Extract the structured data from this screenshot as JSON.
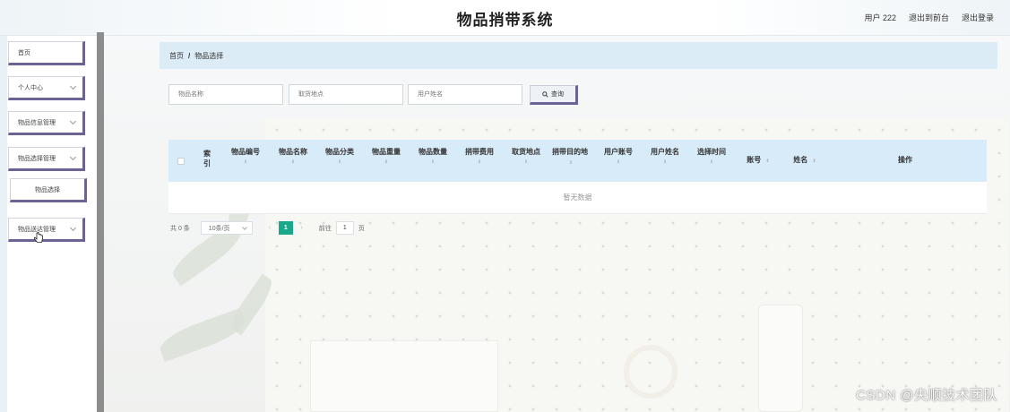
{
  "app": {
    "title": "物品捎带系统"
  },
  "header_links": {
    "user": "用户 222",
    "back_front": "退出到前台",
    "logout": "退出登录"
  },
  "sidebar": {
    "items": [
      {
        "label": "首页"
      },
      {
        "label": "个人中心"
      },
      {
        "label": "物品信息管理"
      },
      {
        "label": "物品选择管理"
      },
      {
        "label": "物品选择"
      },
      {
        "label": "物品送达管理"
      }
    ]
  },
  "breadcrumb": {
    "home": "首页",
    "separator": "/",
    "current": "物品选择"
  },
  "search": {
    "name_placeholder": "物品名称",
    "pickup_placeholder": "取货地点",
    "username_placeholder": "用户姓名",
    "button_label": "查询"
  },
  "table": {
    "columns": [
      "索引",
      "物品编号",
      "物品名称",
      "物品分类",
      "物品重量",
      "物品数量",
      "捎带费用",
      "取货地点",
      "捎带目的地",
      "用户账号",
      "用户姓名",
      "选择时间",
      "账号",
      "姓名",
      "操作"
    ],
    "sort_indicator": "⇕",
    "empty_text": "暂无数据"
  },
  "pagination": {
    "total": "共 0 条",
    "page_size": "10条/页",
    "current_page": "1",
    "goto_label": "前往",
    "goto_value": "1",
    "page_suffix": "页"
  },
  "watermark": "CSDN @央顺技术团队"
}
